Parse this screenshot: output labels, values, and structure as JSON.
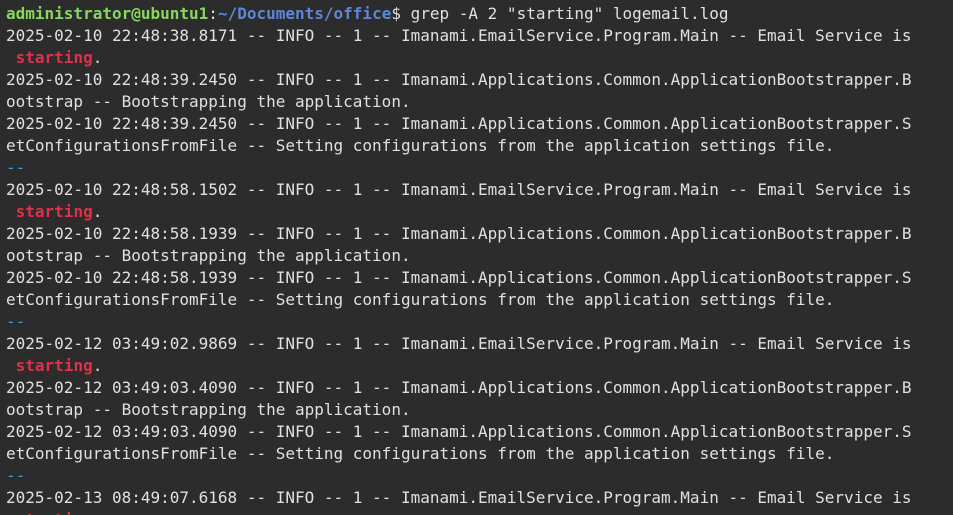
{
  "prompt": {
    "user_host": "administrator@ubuntu1",
    "colon": ":",
    "path": "~/Documents/office",
    "symbol": "$",
    "command": " grep -A 2 \"starting\" logemail.log"
  },
  "colors": {
    "background": "#2c2c2c",
    "text": "#e0e0e0",
    "prompt_user": "#87d75f",
    "prompt_path": "#5f87d7",
    "match": "#e0304a",
    "separator": "#3fa0d4"
  },
  "lines": [
    {
      "type": "text",
      "text": "2025-02-10 22:48:38.8171 -- INFO -- 1 -- Imanami.EmailService.Program.Main -- Email Service is"
    },
    {
      "type": "match",
      "pre": " ",
      "match": "starting",
      "post": "."
    },
    {
      "type": "text",
      "text": "2025-02-10 22:48:39.2450 -- INFO -- 1 -- Imanami.Applications.Common.ApplicationBootstrapper.B"
    },
    {
      "type": "text",
      "text": "ootstrap -- Bootstrapping the application."
    },
    {
      "type": "text",
      "text": "2025-02-10 22:48:39.2450 -- INFO -- 1 -- Imanami.Applications.Common.ApplicationBootstrapper.S"
    },
    {
      "type": "text",
      "text": "etConfigurationsFromFile -- Setting configurations from the application settings file."
    },
    {
      "type": "sep",
      "text": "--"
    },
    {
      "type": "text",
      "text": "2025-02-10 22:48:58.1502 -- INFO -- 1 -- Imanami.EmailService.Program.Main -- Email Service is"
    },
    {
      "type": "match",
      "pre": " ",
      "match": "starting",
      "post": "."
    },
    {
      "type": "text",
      "text": "2025-02-10 22:48:58.1939 -- INFO -- 1 -- Imanami.Applications.Common.ApplicationBootstrapper.B"
    },
    {
      "type": "text",
      "text": "ootstrap -- Bootstrapping the application."
    },
    {
      "type": "text",
      "text": "2025-02-10 22:48:58.1939 -- INFO -- 1 -- Imanami.Applications.Common.ApplicationBootstrapper.S"
    },
    {
      "type": "text",
      "text": "etConfigurationsFromFile -- Setting configurations from the application settings file."
    },
    {
      "type": "sep",
      "text": "--"
    },
    {
      "type": "text",
      "text": "2025-02-12 03:49:02.9869 -- INFO -- 1 -- Imanami.EmailService.Program.Main -- Email Service is"
    },
    {
      "type": "match",
      "pre": " ",
      "match": "starting",
      "post": "."
    },
    {
      "type": "text",
      "text": "2025-02-12 03:49:03.4090 -- INFO -- 1 -- Imanami.Applications.Common.ApplicationBootstrapper.B"
    },
    {
      "type": "text",
      "text": "ootstrap -- Bootstrapping the application."
    },
    {
      "type": "text",
      "text": "2025-02-12 03:49:03.4090 -- INFO -- 1 -- Imanami.Applications.Common.ApplicationBootstrapper.S"
    },
    {
      "type": "text",
      "text": "etConfigurationsFromFile -- Setting configurations from the application settings file."
    },
    {
      "type": "sep",
      "text": "--"
    },
    {
      "type": "text",
      "text": "2025-02-13 08:49:07.6168 -- INFO -- 1 -- Imanami.EmailService.Program.Main -- Email Service is"
    },
    {
      "type": "match",
      "pre": " ",
      "match": "starting",
      "post": "."
    }
  ]
}
